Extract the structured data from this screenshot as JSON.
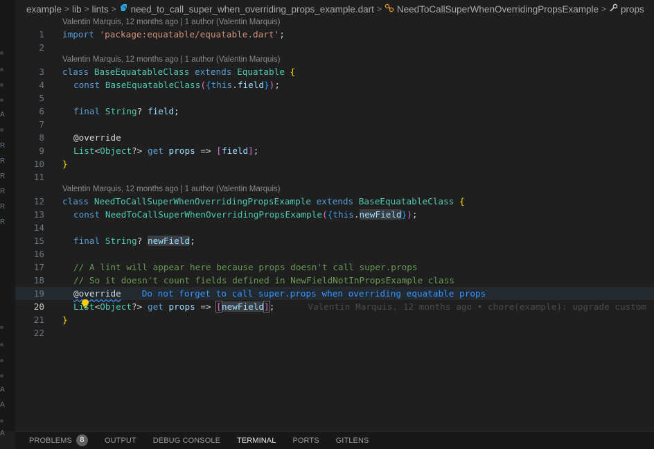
{
  "breadcrumb": {
    "items": [
      "example",
      "lib",
      "lints",
      "need_to_call_super_when_overriding_props_example.dart",
      "NeedToCallSuperWhenOverridingPropsExample",
      "props"
    ],
    "icons": [
      "",
      "",
      "",
      "dart-file-icon",
      "class-icon",
      "wrench-icon"
    ]
  },
  "blame": {
    "header1": "Valentin Marquis, 12 months ago | 1 author (Valentin Marquis)",
    "header2": "Valentin Marquis, 12 months ago | 1 author (Valentin Marquis)",
    "header3": "Valentin Marquis, 12 months ago | 1 author (Valentin Marquis)",
    "inline": "Valentin Marquis, 12 months ago • chore(example): upgrade custom"
  },
  "code": {
    "l1": {
      "kw": "import",
      "str": "'package:equatable/equatable.dart'",
      "end": ";"
    },
    "l3": {
      "kw1": "class",
      "cls1": "BaseEquatableClass",
      "kw2": "extends",
      "cls2": "Equatable",
      "brace": "{"
    },
    "l4": {
      "kw": "const",
      "cls": "BaseEquatableClass",
      "p1": "(",
      "b1": "{",
      "kw2": "this",
      "dot": ".",
      "var": "field",
      "b2": "}",
      "p2": ")",
      "end": ";"
    },
    "l6": {
      "kw": "final",
      "cls": "String",
      "q": "?",
      "var": "field",
      "end": ";"
    },
    "l8": {
      "ann": "@override"
    },
    "l9": {
      "cls1": "List",
      "lt": "<",
      "cls2": "Object",
      "gt": "?>",
      "kw": "get",
      "prop": "props",
      "arrow": "=>",
      "bo": "[",
      "var": "field",
      "bc": "]",
      "end": ";"
    },
    "l10": {
      "brace": "}"
    },
    "l12": {
      "kw1": "class",
      "cls1": "NeedToCallSuperWhenOverridingPropsExample",
      "kw2": "extends",
      "cls2": "BaseEquatableClass",
      "brace": "{"
    },
    "l13": {
      "kw": "const",
      "cls": "NeedToCallSuperWhenOverridingPropsExample",
      "p1": "(",
      "b1": "{",
      "kw2": "this",
      "dot": ".",
      "var": "newField",
      "b2": "}",
      "p2": ")",
      "end": ";"
    },
    "l15": {
      "kw": "final",
      "cls": "String",
      "q": "?",
      "var": "newField",
      "end": ";"
    },
    "l17": {
      "cmt": "// A lint will appear here because props doesn't call super.props"
    },
    "l18": {
      "cmt": "// So it doesn't count fields defined in NewFieldNotInPropsExample class"
    },
    "l19": {
      "ann": "@override",
      "lint": "Do not forget to call super.props when overriding equatable props"
    },
    "l20": {
      "cls1": "List",
      "lt": "<",
      "cls2": "Object",
      "gt": "?>",
      "kw": "get",
      "prop": "props",
      "arrow": "=>",
      "bo": "[",
      "var": "newField",
      "bc": "]",
      "end": ";"
    },
    "l21": {
      "brace": "}"
    }
  },
  "line_numbers": [
    "1",
    "2",
    "3",
    "4",
    "5",
    "6",
    "7",
    "8",
    "9",
    "10",
    "11",
    "12",
    "13",
    "14",
    "15",
    "16",
    "17",
    "18",
    "19",
    "20",
    "21",
    "22"
  ],
  "left_strip_marks": [
    "A",
    "R",
    "R",
    "R",
    "R",
    "R",
    "R",
    "R",
    "A",
    "A",
    "A"
  ],
  "panel": {
    "tabs": [
      "PROBLEMS",
      "OUTPUT",
      "DEBUG CONSOLE",
      "TERMINAL",
      "PORTS",
      "GITLENS"
    ],
    "problems_count": "8",
    "active_tab": "TERMINAL"
  },
  "colors": {
    "background": "#1f1f1f",
    "keyword": "#569cd6",
    "class": "#4ec9b0",
    "string": "#ce9178",
    "comment": "#6a9955",
    "lint": "#3794ff"
  }
}
